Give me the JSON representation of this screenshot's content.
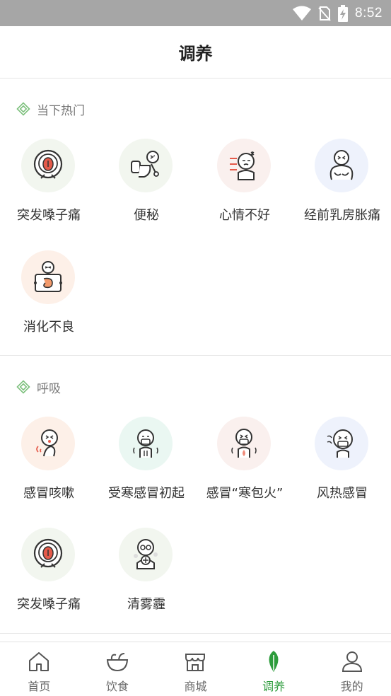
{
  "status_bar": {
    "time": "8:52"
  },
  "header": {
    "title": "调养"
  },
  "sections": [
    {
      "title": "当下热门",
      "items": [
        {
          "label": "突发嗓子痛",
          "icon": "sore-throat-icon"
        },
        {
          "label": "便秘",
          "icon": "constipation-icon"
        },
        {
          "label": "心情不好",
          "icon": "bad-mood-icon"
        },
        {
          "label": "经前乳房胀痛",
          "icon": "breast-pain-icon"
        },
        {
          "label": "消化不良",
          "icon": "indigestion-icon"
        }
      ]
    },
    {
      "title": "呼吸",
      "items": [
        {
          "label": "感冒咳嗽",
          "icon": "cough-icon"
        },
        {
          "label": "受寒感冒初起",
          "icon": "cold-chill-icon"
        },
        {
          "label": "感冒“寒包火”",
          "icon": "cold-fire-icon"
        },
        {
          "label": "风热感冒",
          "icon": "wind-heat-cold-icon"
        },
        {
          "label": "突发嗓子痛",
          "icon": "sore-throat-icon"
        },
        {
          "label": "清雾霾",
          "icon": "smog-mask-icon"
        }
      ]
    }
  ],
  "tabs": [
    {
      "label": "首页",
      "icon": "home-icon"
    },
    {
      "label": "饮食",
      "icon": "bowl-icon"
    },
    {
      "label": "商城",
      "icon": "shop-icon"
    },
    {
      "label": "调养",
      "icon": "leaf-icon"
    },
    {
      "label": "我的",
      "icon": "user-icon"
    }
  ],
  "colors": {
    "accent": "#2d9c3c",
    "status_bar": "#a6a6a6",
    "line": "#333333",
    "red": "#e55a4a"
  }
}
